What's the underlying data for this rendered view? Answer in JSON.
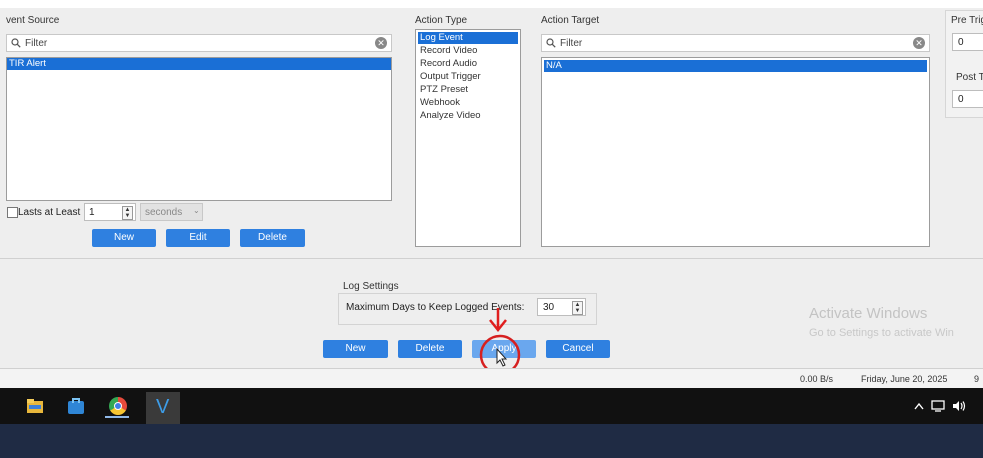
{
  "event_source": {
    "label": "vent Source",
    "filter_placeholder": "Filter",
    "selected_item": "TIR Alert",
    "lasts_label": "Lasts at Least",
    "lasts_value": "1",
    "duration_unit": "seconds",
    "buttons": {
      "new": "New",
      "edit": "Edit",
      "delete": "Delete"
    }
  },
  "action_type": {
    "label": "Action Type",
    "items": [
      "Log Event",
      "Record Video",
      "Record Audio",
      "Output Trigger",
      "PTZ Preset",
      "Webhook",
      "Analyze Video"
    ],
    "selected_index": 0
  },
  "action_target": {
    "label": "Action Target",
    "filter_placeholder": "Filter",
    "selected_item": "N/A"
  },
  "pre_trigger": {
    "label": "Pre Trig",
    "value": "0"
  },
  "post_trigger": {
    "label": "Post Tr",
    "value": "0"
  },
  "log_settings": {
    "title": "Log Settings",
    "max_days_label": "Maximum Days to Keep Logged Events:",
    "max_days_value": "30"
  },
  "bottom_buttons": {
    "new": "New",
    "delete": "Delete",
    "apply": "Apply",
    "cancel": "Cancel"
  },
  "watermark": {
    "line1": "Activate Windows",
    "line2": "Go to Settings to activate Win"
  },
  "status_bar": {
    "rate": "0.00 B/s",
    "date": "Friday, June 20, 2025",
    "time_partial": "9"
  },
  "taskbar": {
    "apps": [
      "file-explorer-icon",
      "store-icon",
      "chrome-icon",
      "v-app-icon"
    ],
    "tray": [
      "chevron-up-icon",
      "network-icon",
      "volume-icon"
    ]
  },
  "annotation_colors": {
    "arrow": "#e01e1e",
    "circle": "#d62020"
  }
}
